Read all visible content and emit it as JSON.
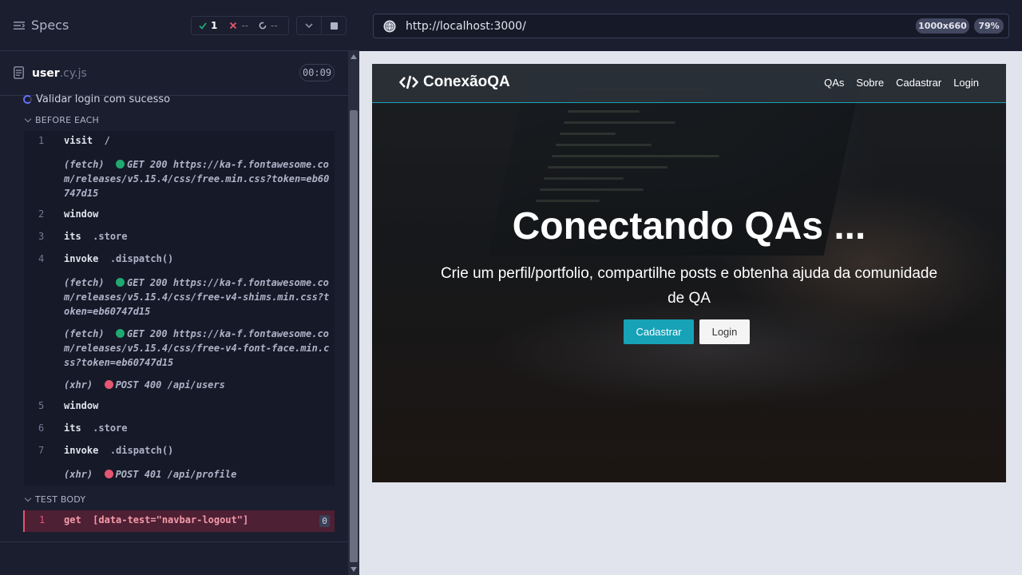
{
  "reporter": {
    "specs_label": "Specs",
    "stats": {
      "passed": "1",
      "failed": "--",
      "pending": "--"
    },
    "spec_file": {
      "base": "user",
      "ext": ".cy.js",
      "duration": "00:09"
    },
    "test_title": "Validar login com sucesso",
    "before_each_label": "BEFORE EACH",
    "test_body_label": "TEST BODY",
    "commands": [
      {
        "num": "1",
        "name": "visit",
        "message": "/"
      },
      {
        "event": "(fetch)",
        "status": "GET 200",
        "url": "https://ka-f.fontawesome.com/releases/v5.15.4/css/free.min.css?token=eb60747d15"
      },
      {
        "num": "2",
        "name": "window",
        "message": ""
      },
      {
        "num": "3",
        "name": "its",
        "message": ".store"
      },
      {
        "num": "4",
        "name": "invoke",
        "message": ".dispatch()"
      },
      {
        "event": "(fetch)",
        "status": "GET 200",
        "url": "https://ka-f.fontawesome.com/releases/v5.15.4/css/free-v4-shims.min.css?token=eb60747d15"
      },
      {
        "event": "(fetch)",
        "status": "GET 200",
        "url": "https://ka-f.fontawesome.com/releases/v5.15.4/css/free-v4-font-face.min.css?token=eb60747d15"
      },
      {
        "event": "(xhr)",
        "status": "POST 400",
        "url": "/api/users"
      },
      {
        "num": "5",
        "name": "window",
        "message": ""
      },
      {
        "num": "6",
        "name": "its",
        "message": ".store"
      },
      {
        "num": "7",
        "name": "invoke",
        "message": ".dispatch()"
      },
      {
        "event": "(xhr)",
        "status": "POST 401",
        "url": "/api/profile"
      }
    ],
    "test_body_command": {
      "num": "1",
      "name": "get",
      "message": "[data-test=\"navbar-logout\"]",
      "count": "0"
    }
  },
  "aut": {
    "url": "http://localhost:3000/",
    "viewport_size": "1000x660",
    "zoom": "79%",
    "site": {
      "brand": "ConexãoQA",
      "nav": [
        "QAs",
        "Sobre",
        "Cadastrar",
        "Login"
      ],
      "hero_title": "Conectando QAs ...",
      "hero_subtitle": "Crie um perfil/portfolio, compartilhe posts e obtenha ajuda da comunidade de QA",
      "btn_primary": "Cadastrar",
      "btn_secondary": "Login"
    }
  },
  "colors": {
    "pass": "#1fa971",
    "fail": "#e45770",
    "accent": "#17a2b8",
    "running": "#6470f3"
  }
}
